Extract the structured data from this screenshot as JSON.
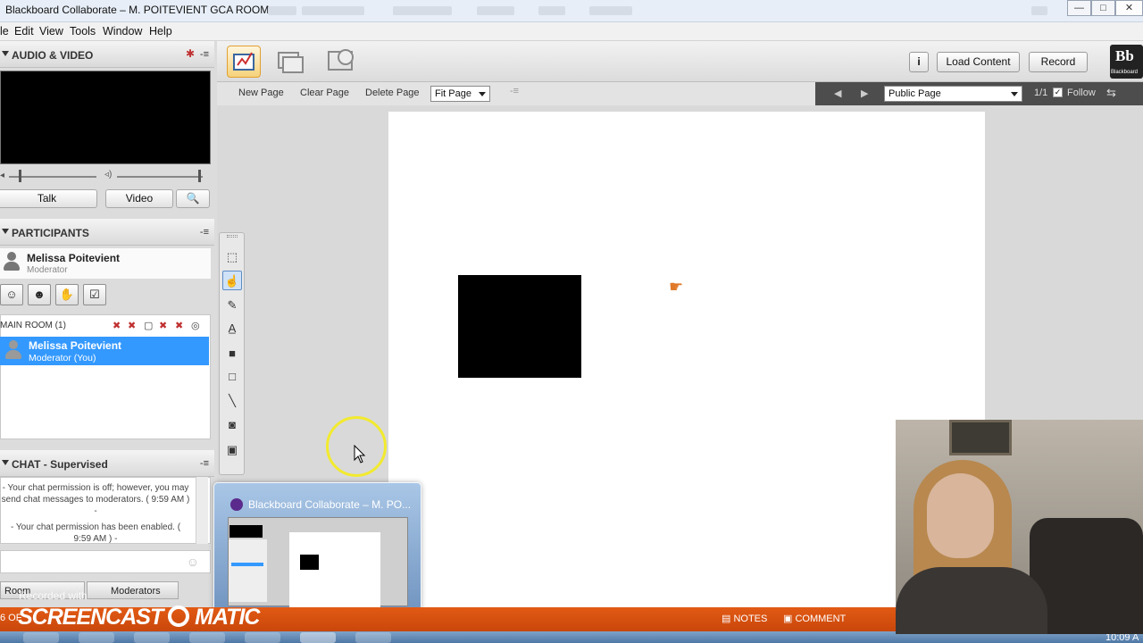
{
  "window": {
    "title": "Blackboard Collaborate – M. POITEVIENT GCA ROOM",
    "controls": {
      "minimize": "—",
      "maximize": "□",
      "close": "✕"
    }
  },
  "menu": [
    "le",
    "Edit",
    "View",
    "Tools",
    "Window",
    "Help"
  ],
  "audio_video": {
    "header": "AUDIO & VIDEO",
    "talk_label": "Talk",
    "video_label": "Video"
  },
  "participants": {
    "header": "PARTICIPANTS",
    "user_name": "Melissa Poitevient",
    "user_role": "Moderator",
    "room_label": "MAIN ROOM",
    "room_count": "(1)",
    "selected_name": "Melissa Poitevient",
    "selected_role": "Moderator (You)"
  },
  "chat": {
    "header": "CHAT - Supervised",
    "messages": [
      "- Your chat permission is off; however, you may send chat messages to moderators. ( 9:59 AM ) -",
      "- Your chat permission has been enabled. ( 9:59 AM ) -"
    ],
    "tab_room": "Room",
    "tab_moderators": "Moderators"
  },
  "toolbar": {
    "load_content": "Load Content",
    "record": "Record",
    "info_icon": "i",
    "logo": "Bb",
    "logo_sub": "Blackboard"
  },
  "whiteboard": {
    "new_page": "New Page",
    "clear_page": "Clear Page",
    "delete_page": "Delete Page",
    "zoom": "Fit Page",
    "page_view": "Public Page",
    "page_num": "1/1",
    "follow": "Follow"
  },
  "preview": {
    "title": "Blackboard Collaborate – M. PO..."
  },
  "status": {
    "left": "6 OF",
    "notes": "NOTES",
    "comment": "COMMENT",
    "recorded_with": "Recorded with",
    "brand": "SCREENCAST",
    "brand2": "MATIC",
    "clock": "10:09 A"
  },
  "colors": {
    "selection": "#3399ff",
    "status_bar": "#d9500f",
    "cursor_highlight": "#f2ea2e"
  }
}
